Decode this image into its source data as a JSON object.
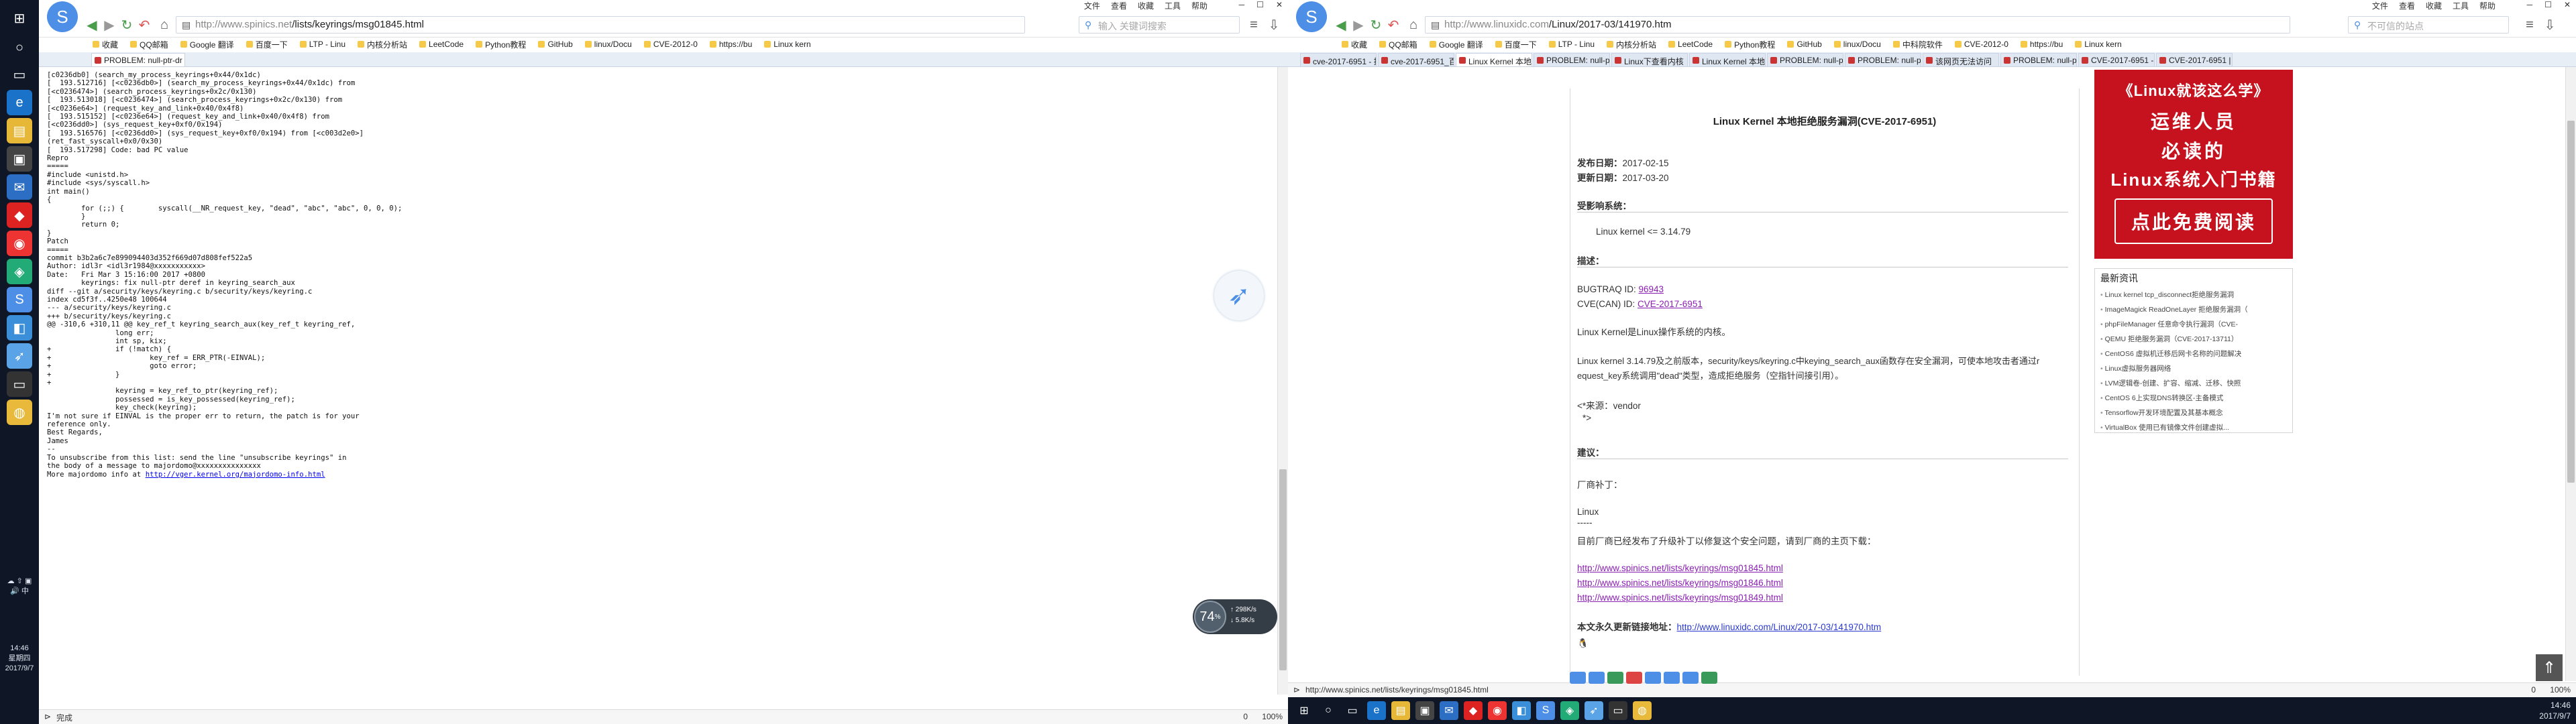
{
  "left": {
    "browser": {
      "menus": [
        "文件",
        "查看",
        "收藏",
        "工具",
        "帮助"
      ],
      "url_host": "http://www.spinics.net",
      "url_path": "/lists/keyrings/msg01845.html",
      "search_placeholder": "输入 关键词搜索",
      "bookmarks": [
        "收藏",
        "QQ邮箱",
        "Google 翻译",
        "百度一下",
        "LTP - Linu",
        "内核分析站",
        "LeetCode",
        "Python教程",
        "GitHub",
        "linux/Docu",
        "CVE-2012-0",
        "https://bu",
        "Linux kern"
      ],
      "tabs": [
        {
          "label": "PROBLEM: null-ptr-dr",
          "active": true
        }
      ],
      "status_text": "完成",
      "zoom": "100%",
      "status_count": "0"
    },
    "mail_lines": [
      "[c0236db0] (search_my_process_keyrings+0x44/0x1dc)",
      "[  193.512716] [<c0236db0>] (search_my_process_keyrings+0x44/0x1dc) from",
      "[<c0236474>] (search_process_keyrings+0x2c/0x130)",
      "[  193.513018] [<c0236474>] (search_process_keyrings+0x2c/0x130) from",
      "[<c0236e64>] (request_key_and_link+0x40/0x4f8)",
      "[  193.515152] [<c0236e64>] (request_key_and_link+0x40/0x4f8) from",
      "[<c0236dd0>] (sys_request_key+0xf0/0x194)",
      "[  193.516576] [<c0236dd0>] (sys_request_key+0xf0/0x194) from [<c003d2e0>]",
      "(ret_fast_syscall+0x0/0x30)",
      "[  193.517298] Code: bad PC value",
      "",
      "",
      "Repro",
      "=====",
      "#include <unistd.h>",
      "#include <sys/syscall.h>",
      "",
      "int main()",
      "{",
      "        for (;;) {        syscall(__NR_request_key, \"dead\", \"abc\", \"abc\", 0, 0, 0);",
      "",
      "        }",
      "",
      "        return 0;",
      "}",
      "",
      "",
      "Patch",
      "=====",
      "commit b3b2a6c7e899094403d352f669d07d808fef522a5",
      "Author: idl3r <idl3r1984@xxxxxxxxxxx>",
      "Date:   Fri Mar 3 15:16:00 2017 +0800",
      "",
      "        keyrings: fix null-ptr deref in keyring_search_aux",
      "",
      "diff --git a/security/keys/keyring.c b/security/keys/keyring.c",
      "index cd5f3f..4250e48 100644",
      "--- a/security/keys/keyring.c",
      "+++ b/security/keys/keyring.c",
      "@@ -310,6 +310,11 @@ key_ref_t keyring_search_aux(key_ref_t keyring_ref,",
      "                long err;",
      "                int sp, kix;",
      "",
      "+               if (!match) {",
      "+                       key_ref = ERR_PTR(-EINVAL);",
      "+                       goto error;",
      "+               }",
      "+",
      "                keyring = key_ref_to_ptr(keyring_ref);",
      "                possessed = is_key_possessed(keyring_ref);",
      "                key_check(keyring);",
      "",
      "",
      "I'm not sure if EINVAL is the proper err to return, the patch is for your",
      "reference only.",
      "",
      "Best Regards,",
      "James",
      "",
      "--",
      "To unsubscribe from this list: send the line \"unsubscribe keyrings\" in",
      "the body of a message to majordomo@xxxxxxxxxxxxxxx",
      "More majordomo info at "
    ],
    "majordomo_link": "http://vger.kernel.org/majordomo-info.html",
    "speed": {
      "percent": "74",
      "unit": "%",
      "up": "298K/s",
      "down": "5.8K/s"
    },
    "taskbar": {
      "time": "14:46",
      "day": "星期四",
      "date": "2017/9/7"
    }
  },
  "right": {
    "browser": {
      "menus": [
        "文件",
        "查看",
        "收藏",
        "工具",
        "帮助"
      ],
      "url_host": "http://www.linuxidc.com",
      "url_path": "/Linux/2017-03/141970.htm",
      "search_placeholder": "不可信的站点",
      "bookmarks": [
        "收藏",
        "QQ邮箱",
        "Google 翻译",
        "百度一下",
        "LTP - Linu",
        "内核分析站",
        "LeetCode",
        "Python教程",
        "GitHub",
        "linux/Docu",
        "中科院软件",
        "CVE-2012-0",
        "https://bu",
        "Linux kern"
      ],
      "tabs": [
        {
          "label": "cve-2017-6951 - 搜",
          "active": false
        },
        {
          "label": "cve-2017-6951_百",
          "active": false
        },
        {
          "label": "Linux Kernel 本地打",
          "active": true
        },
        {
          "label": "PROBLEM: null-ptr",
          "active": false
        },
        {
          "label": "Linux下查看内核",
          "active": false
        },
        {
          "label": "Linux Kernel 本地打",
          "active": false
        },
        {
          "label": "PROBLEM: null-ptr",
          "active": false
        },
        {
          "label": "PROBLEM: null-ptr",
          "active": false
        },
        {
          "label": "该网页无法访问",
          "active": false
        },
        {
          "label": "PROBLEM: null-ptr",
          "active": false
        },
        {
          "label": "CVE-2017-6951 - ",
          "active": false
        },
        {
          "label": "CVE-2017-6951 | ",
          "active": false
        }
      ],
      "status_url": "http://www.spinics.net/lists/keyrings/msg01845.html",
      "zoom": "100%",
      "status_count": "0"
    },
    "article": {
      "title": "Linux Kernel 本地拒绝服务漏洞(CVE-2017-6951)",
      "release_label": "发布日期：",
      "release_date": "2017-02-15",
      "update_label": "更新日期：",
      "update_date": "2017-03-20",
      "affected_label": "受影响系统：",
      "affected_value": "Linux kernel <= 3.14.79",
      "desc_label": "描述：",
      "bugtraq_label": "BUGTRAQ  ID: ",
      "bugtraq_id": "96943",
      "cve_label": "CVE(CAN) ID: ",
      "cve_id": "CVE-2017-6951",
      "p1": "Linux Kernel是Linux操作系统的内核。",
      "p2a": "Linux kernel 3.14.79及之前版本，security/keys/keyring.c中keying_search_aux函数存在安全漏洞，可使本地攻击者通过r",
      "p2b": "equest_key系统调用\"dead\"类型，造成拒绝服务（空指针间接引用）。",
      "source_label": "<*来源：vendor",
      "source_end": "*>",
      "advice_label": "建议：",
      "vendor_patch": "厂商补丁：",
      "vendor_name": "Linux",
      "vendor_sep": "-----",
      "vendor_msg": "目前厂商已经发布了升级补丁以修复这个安全问题，请到厂商的主页下载：",
      "links": [
        "http://www.spinics.net/lists/keyrings/msg01845.html",
        "http://www.spinics.net/lists/keyrings/msg01846.html",
        "http://www.spinics.net/lists/keyrings/msg01849.html"
      ],
      "permalink_label": "本文永久更新链接地址：",
      "permalink": "http://www.linuxidc.com/Linux/2017-03/141970.htm"
    },
    "ad": {
      "line1": "《Linux就该这么学》",
      "line2": "运维人员",
      "line3": "必读的",
      "line4": "Linux系统入门书籍",
      "button": "点此免费阅读"
    },
    "latest": {
      "title": "最新资讯",
      "items": [
        "Linux kernel tcp_disconnect拒绝服务漏洞",
        "ImageMagick ReadOneLayer 拒绝服务漏洞（",
        "phpFileManager 任意命令执行漏洞（CVE-",
        "QEMU 拒绝服务漏洞（CVE-2017-13711）",
        "CentOS6 虚拟机迁移后网卡名称的问题解决",
        "Linux虚拟服务器网络",
        "LVM逻辑卷-创建、扩容、缩减、迁移、快照",
        "CentOS 6上实现DNS转换区-主备模式",
        "Tensorflow开发环境配置及其基本概念",
        "VirtualBox 使用已有镜像文件创建虚拟..."
      ]
    },
    "taskbar": {
      "time": "14:46",
      "date": "2017/9/7"
    }
  }
}
